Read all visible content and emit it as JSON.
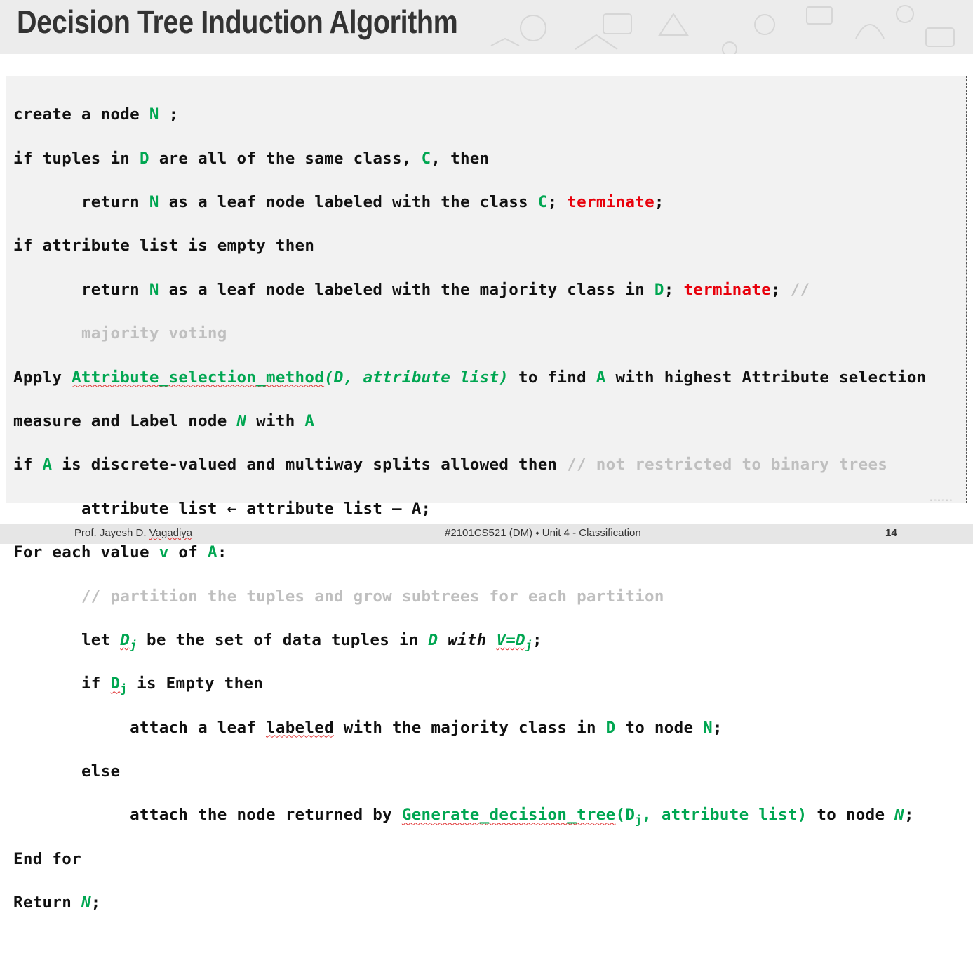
{
  "slide": {
    "title": "Decision Tree Induction Algorithm"
  },
  "code": {
    "l1": {
      "a": "create a node ",
      "b": "N",
      "c": " ;"
    },
    "l2": {
      "a": "if tuples in ",
      "b": "D",
      "c": " are all of the same class, ",
      "d": "C",
      "e": ", then"
    },
    "l3": {
      "a": "return ",
      "b": "N",
      "c": " as a leaf node labeled with the class ",
      "d": "C",
      "e": "; ",
      "f": "terminate",
      "g": ";"
    },
    "l4": {
      "a": "if attribute list is empty then"
    },
    "l5": {
      "a": "return ",
      "b": "N",
      "c": " as a leaf node labeled with the majority class in ",
      "d": "D",
      "e": "; ",
      "f": "terminate",
      "g": "; ",
      "h": "//"
    },
    "l6": {
      "a": "majority voting"
    },
    "l7": {
      "a": "Apply ",
      "b": "Attribute_selection_method",
      "c": "(D, attribute list)",
      "d": " to find ",
      "e": "A",
      "f": " with highest Attribute selection"
    },
    "l8": {
      "a": "measure and Label node ",
      "b": "N",
      "c": " with ",
      "d": "A"
    },
    "l9": {
      "a": "if ",
      "b": "A",
      "c": " is discrete-valued and multiway splits allowed then ",
      "d": "// not restricted to binary trees"
    },
    "l10": {
      "a": "attribute list ← attribute list – A;"
    },
    "l11": {
      "a": "For each value ",
      "b": "v",
      "c": " of ",
      "d": "A",
      "e": ":"
    },
    "l12": {
      "a": "// partition the tuples and grow subtrees for each partition"
    },
    "l13": {
      "a": "let ",
      "b": "D",
      "sub1": "j",
      "c": " be the set of data tuples in ",
      "d": "D",
      "e": " with ",
      "f": "V=D",
      "sub2": "j",
      "g": ";"
    },
    "l14": {
      "a": "if ",
      "b": "D",
      "sub": "j",
      "c": " is Empty then"
    },
    "l15": {
      "a": "attach a leaf ",
      "b": "labeled",
      "c": " with the majority class in ",
      "d": "D",
      "e": " to node ",
      "f": "N",
      "g": ";"
    },
    "l16": {
      "a": "else"
    },
    "l17": {
      "a": "attach the node returned by ",
      "b": "Generate_decision_tree",
      "c": "(D",
      "sub": "j",
      "d": ", attribute list)",
      "e": " to node ",
      "f": "N",
      "g": ";"
    },
    "l18": {
      "a": "End for"
    },
    "l19": {
      "a": "Return ",
      "b": "N",
      "c": ";"
    }
  },
  "footer": {
    "author_prefix": "Prof. Jayesh D. ",
    "author_surname": "Vagadiya",
    "course": "#2101CS521  (DM)  ⬩  Unit 4 - Classification",
    "page": "14"
  },
  "colors": {
    "keyword_green": "#00a651",
    "terminate_red": "#e8000b",
    "comment_gray": "#bfbfbf",
    "header_bg": "#ececec",
    "footer_bg": "#e6e6e6"
  }
}
